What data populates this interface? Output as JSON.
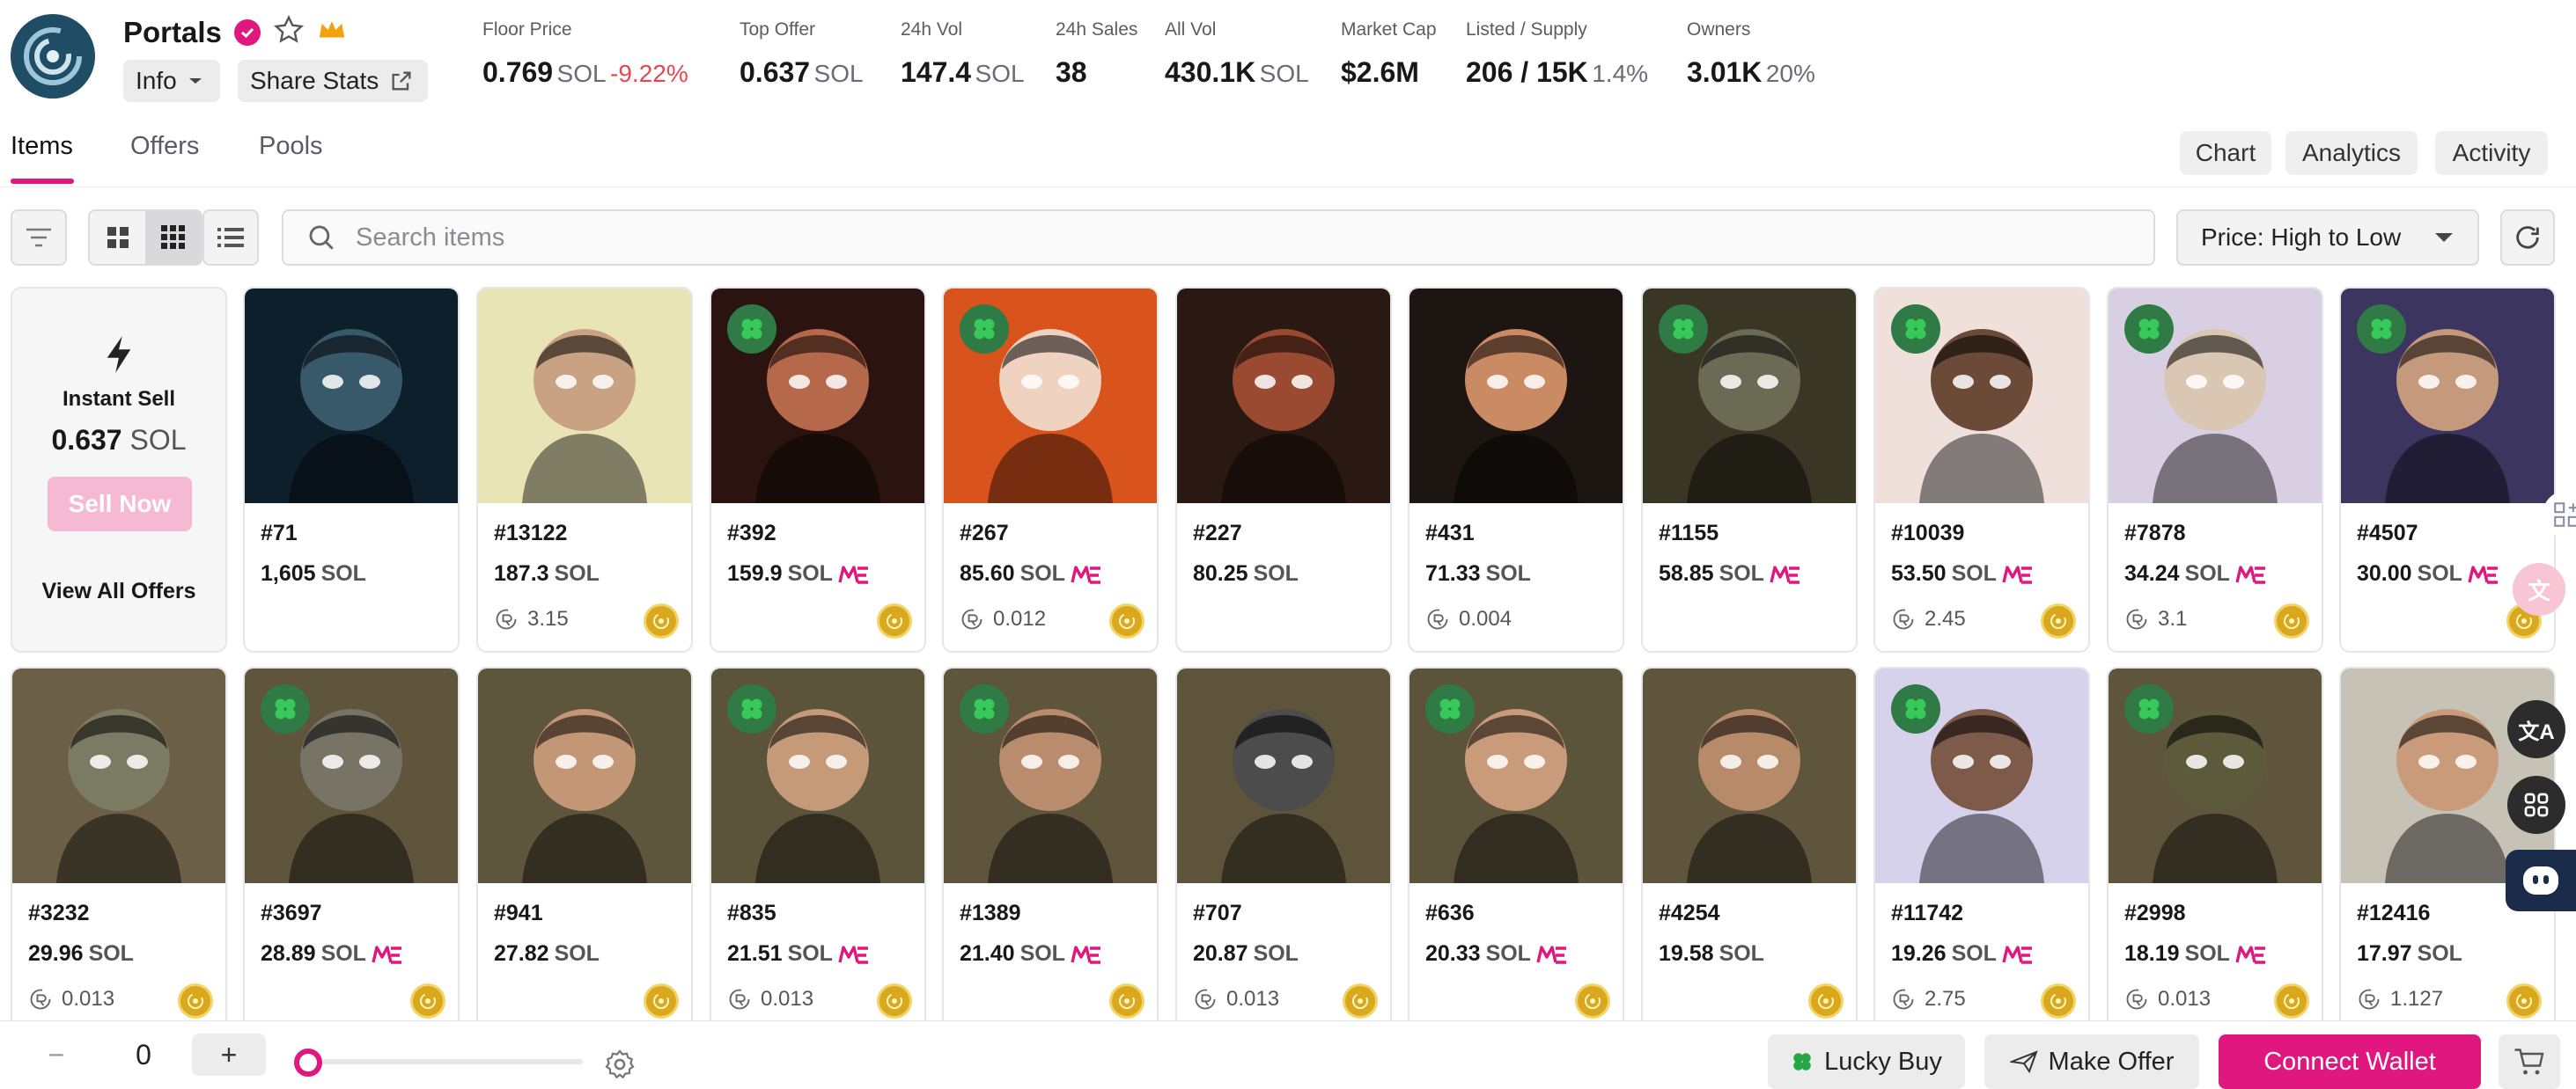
{
  "collection": {
    "name": "Portals"
  },
  "header": {
    "info_label": "Info",
    "share_label": "Share Stats"
  },
  "stats": [
    {
      "label": "Floor Price",
      "value": "0.769",
      "unit": "SOL",
      "extra": "-9.22%"
    },
    {
      "label": "Top Offer",
      "value": "0.637",
      "unit": "SOL",
      "extra": ""
    },
    {
      "label": "24h Vol",
      "value": "147.4",
      "unit": "SOL",
      "extra": ""
    },
    {
      "label": "24h Sales",
      "value": "38",
      "unit": "",
      "extra": ""
    },
    {
      "label": "All Vol",
      "value": "430.1K",
      "unit": "SOL",
      "extra": ""
    },
    {
      "label": "Market Cap",
      "value": "$2.6M",
      "unit": "",
      "extra": ""
    },
    {
      "label": "Listed / Supply",
      "value": "206 / 15K",
      "unit": "1.4%",
      "extra": ""
    },
    {
      "label": "Owners",
      "value": "3.01K",
      "unit": "20%",
      "extra": ""
    }
  ],
  "tabs": [
    "Items",
    "Offers",
    "Pools"
  ],
  "right_buttons": [
    "Chart",
    "Analytics",
    "Activity"
  ],
  "search": {
    "placeholder": "Search items"
  },
  "sort": {
    "label": "Price: High to Low"
  },
  "instant_sell": {
    "title": "Instant Sell",
    "price": "0.637",
    "unit": "SOL",
    "button": "Sell Now",
    "link": "View All Offers"
  },
  "items": [
    {
      "id": "#71",
      "price": "1,605",
      "unit": "SOL",
      "me": false,
      "royalty": "",
      "clover": false,
      "coin": false,
      "bg": "#0d1f2a",
      "skin": "#38596a"
    },
    {
      "id": "#13122",
      "price": "187.3",
      "unit": "SOL",
      "me": false,
      "royalty": "3.15",
      "clover": false,
      "coin": true,
      "bg": "#e9e4b6",
      "skin": "#c9a284"
    },
    {
      "id": "#392",
      "price": "159.9",
      "unit": "SOL",
      "me": true,
      "royalty": "",
      "clover": true,
      "coin": true,
      "bg": "#2b140f",
      "skin": "#b5684a"
    },
    {
      "id": "#267",
      "price": "85.60",
      "unit": "SOL",
      "me": true,
      "royalty": "0.012",
      "clover": true,
      "coin": true,
      "bg": "#d9531c",
      "skin": "#f0d2c0"
    },
    {
      "id": "#227",
      "price": "80.25",
      "unit": "SOL",
      "me": false,
      "royalty": "",
      "clover": false,
      "coin": false,
      "bg": "#2a1812",
      "skin": "#9a4a31"
    },
    {
      "id": "#431",
      "price": "71.33",
      "unit": "SOL",
      "me": false,
      "royalty": "0.004",
      "clover": false,
      "coin": false,
      "bg": "#1d1512",
      "skin": "#c98a64"
    },
    {
      "id": "#1155",
      "price": "58.85",
      "unit": "SOL",
      "me": true,
      "royalty": "",
      "clover": true,
      "coin": false,
      "bg": "#3a3626",
      "skin": "#6b6a55"
    },
    {
      "id": "#10039",
      "price": "53.50",
      "unit": "SOL",
      "me": true,
      "royalty": "2.45",
      "clover": true,
      "coin": true,
      "bg": "#efe0dc",
      "skin": "#6b4a38"
    },
    {
      "id": "#7878",
      "price": "34.24",
      "unit": "SOL",
      "me": true,
      "royalty": "3.1",
      "clover": true,
      "coin": true,
      "bg": "#d9cfe2",
      "skin": "#d9c7b4"
    },
    {
      "id": "#4507",
      "price": "30.00",
      "unit": "SOL",
      "me": true,
      "royalty": "",
      "clover": true,
      "coin": true,
      "bg": "#3b3560",
      "skin": "#c59a7c"
    },
    {
      "id": "#3232",
      "price": "29.96",
      "unit": "SOL",
      "me": false,
      "royalty": "0.013",
      "clover": false,
      "coin": true,
      "bg": "#6b6047",
      "skin": "#7b7a62"
    },
    {
      "id": "#3697",
      "price": "28.89",
      "unit": "SOL",
      "me": true,
      "royalty": "",
      "clover": true,
      "coin": true,
      "bg": "#5e553c",
      "skin": "#777466"
    },
    {
      "id": "#941",
      "price": "27.82",
      "unit": "SOL",
      "me": false,
      "royalty": "",
      "clover": false,
      "coin": true,
      "bg": "#5e553d",
      "skin": "#c39676"
    },
    {
      "id": "#835",
      "price": "21.51",
      "unit": "SOL",
      "me": true,
      "royalty": "0.013",
      "clover": true,
      "coin": true,
      "bg": "#5c533b",
      "skin": "#c49a78"
    },
    {
      "id": "#1389",
      "price": "21.40",
      "unit": "SOL",
      "me": true,
      "royalty": "",
      "clover": true,
      "coin": true,
      "bg": "#5e553c",
      "skin": "#b88c6c"
    },
    {
      "id": "#707",
      "price": "20.87",
      "unit": "SOL",
      "me": false,
      "royalty": "0.013",
      "clover": false,
      "coin": true,
      "bg": "#5d543b",
      "skin": "#4c4c4c"
    },
    {
      "id": "#636",
      "price": "20.33",
      "unit": "SOL",
      "me": true,
      "royalty": "",
      "clover": true,
      "coin": true,
      "bg": "#5c533b",
      "skin": "#c99b7a"
    },
    {
      "id": "#4254",
      "price": "19.58",
      "unit": "SOL",
      "me": false,
      "royalty": "",
      "clover": false,
      "coin": true,
      "bg": "#5e553c",
      "skin": "#b78a6a"
    },
    {
      "id": "#11742",
      "price": "19.26",
      "unit": "SOL",
      "me": true,
      "royalty": "2.75",
      "clover": true,
      "coin": true,
      "bg": "#d6d2ec",
      "skin": "#7d5a4a"
    },
    {
      "id": "#2998",
      "price": "18.19",
      "unit": "SOL",
      "me": true,
      "royalty": "0.013",
      "clover": true,
      "coin": true,
      "bg": "#5e553c",
      "skin": "#5d5a3c"
    },
    {
      "id": "#12416",
      "price": "17.97",
      "unit": "SOL",
      "me": false,
      "royalty": "1.127",
      "clover": false,
      "coin": true,
      "bg": "#c7c2b6",
      "skin": "#c99b7a"
    }
  ],
  "bottom": {
    "quantity": "0",
    "minus": "−",
    "plus": "+",
    "lucky_buy": "Lucky Buy",
    "make_offer": "Make Offer",
    "connect_wallet": "Connect Wallet"
  },
  "colors": {
    "accent": "#e0177f",
    "negative": "#e5484d"
  },
  "icons": [
    "verified-icon",
    "star-icon",
    "crown-icon",
    "chevron-down-icon",
    "share-icon",
    "filter-icon",
    "grid-large-icon",
    "grid-small-icon",
    "list-icon",
    "search-icon",
    "refresh-icon",
    "lightning-icon",
    "clover-icon",
    "coin-icon",
    "magic-eden-icon",
    "royalty-icon",
    "settings-icon",
    "cart-icon",
    "plane-icon"
  ]
}
